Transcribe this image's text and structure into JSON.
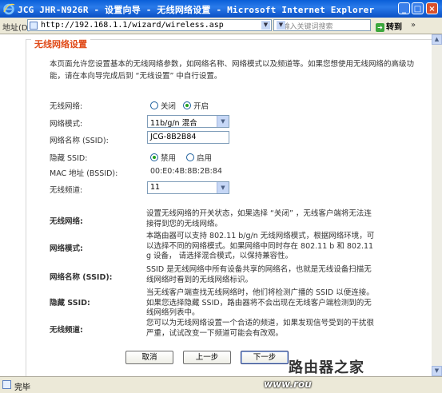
{
  "window": {
    "title": "JCG JHR-N926R - 设置向导 - 无线网络设置 - Microsoft Internet Explorer"
  },
  "address_bar": {
    "label": "地址(D)",
    "url": "http://192.168.1.1/wizard/wireless.asp",
    "search_placeholder": "←输入关键词搜索",
    "go_label": "转到",
    "links_label": "»"
  },
  "panel": {
    "title": "无线网络设置",
    "intro": "本页面允许您设置基本的无线网络参数，如网络名称、网络模式以及频道等。如果您想使用无线网络的高级功能，请在本向导完成后到 “无线设置” 中自行设置。"
  },
  "form": {
    "wireless": {
      "label": "无线网络:",
      "off": "关闭",
      "on": "开启",
      "selected": "on"
    },
    "mode": {
      "label": "网络模式:",
      "value": "11b/g/n 混合"
    },
    "ssid": {
      "label": "网络名称 (SSID):",
      "value": "JCG-8B2B84"
    },
    "hide": {
      "label": "隐藏  SSID:",
      "disable": "禁用",
      "enable": "启用",
      "selected": "disable"
    },
    "mac": {
      "label": "MAC 地址  (BSSID):",
      "value": "00:E0:4B:8B:2B:84"
    },
    "channel": {
      "label": "无线频道:",
      "value": "11"
    }
  },
  "help": [
    {
      "label": "无线网络:",
      "text": "设置无线网络的开关状态，如果选择 “关闭” ，无线客户端将无法连接得到您的无线网络。"
    },
    {
      "label": "网络模式:",
      "text": "本路由器可以支持 802.11 b/g/n 无线网络模式，根据网络环境，可以选择不同的网络模式。如果网络中同时存在 802.11 b 和 802.11 g 设备， 请选择混合模式，以保持兼容性。"
    },
    {
      "label": "网络名称 (SSID):",
      "text": "SSID 是无线网络中所有设备共享的网络名，也就是无线设备扫描无线网络时看到的无线网络标识。"
    },
    {
      "label": "隐藏  SSID:",
      "text": "当无线客户端查找无线网络时，他们将检测广播的 SSID 以便连接。如果您选择隐藏 SSID，路由器将不会出现在无线客户端检测到的无线网络列表中。"
    },
    {
      "label": "无线频道:",
      "text": "您可以为无线网络设置一个合适的频道，如果发现信号受到的干扰很严重，试试改变一下频道可能会有改观。"
    }
  ],
  "buttons": {
    "cancel": "取消",
    "prev": "上一步",
    "next": "下一步"
  },
  "status": {
    "text": "完毕"
  },
  "watermark": {
    "cn": "路由器之家",
    "url": "www.rou"
  }
}
